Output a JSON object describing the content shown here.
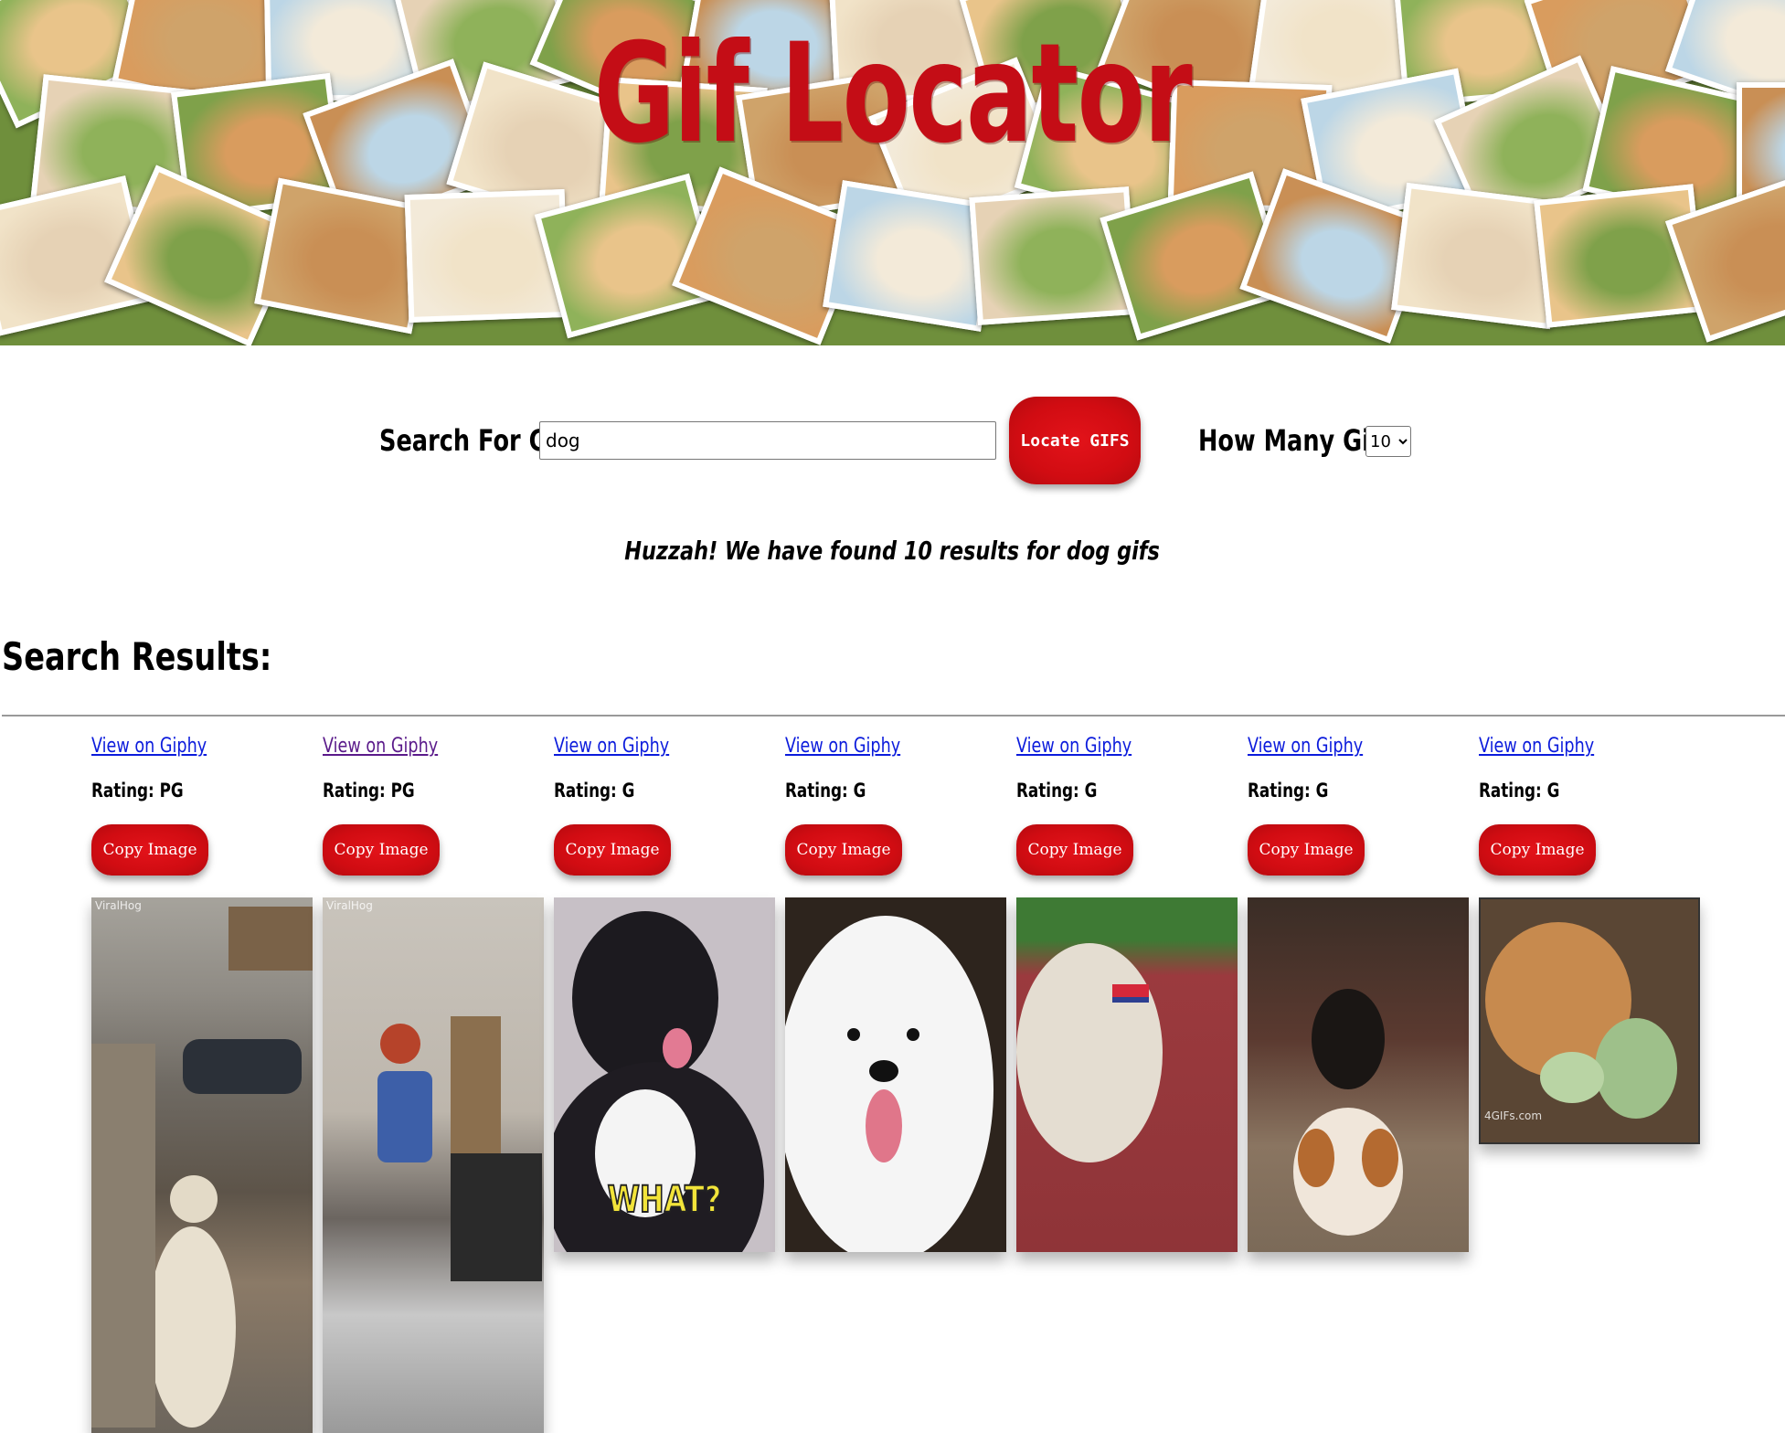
{
  "header": {
    "title": "Gif Locator",
    "banner_icon": "dog-collage-banner"
  },
  "search": {
    "label": "Search For Gif:",
    "value": "dog",
    "button_label": "Locate GIFS",
    "count_label": "How Many Gifs:",
    "count_value": "10"
  },
  "status": {
    "message": "Huzzah! We have found 10 results for dog gifs"
  },
  "results": {
    "heading": "Search Results:",
    "items": [
      {
        "link": "View on Giphy",
        "rating": "Rating: PG",
        "copy": "Copy Image",
        "watermark": "ViralHog",
        "caption": ""
      },
      {
        "link": "View on Giphy",
        "rating": "Rating: PG",
        "copy": "Copy Image",
        "watermark": "ViralHog",
        "caption": ""
      },
      {
        "link": "View on Giphy",
        "rating": "Rating: G",
        "copy": "Copy Image",
        "watermark": "",
        "caption": "WHAT?"
      },
      {
        "link": "View on Giphy",
        "rating": "Rating: G",
        "copy": "Copy Image",
        "watermark": "",
        "caption": ""
      },
      {
        "link": "View on Giphy",
        "rating": "Rating: G",
        "copy": "Copy Image",
        "watermark": "",
        "caption": ""
      },
      {
        "link": "View on Giphy",
        "rating": "Rating: G",
        "copy": "Copy Image",
        "watermark": "",
        "caption": ""
      },
      {
        "link": "View on Giphy",
        "rating": "Rating: G",
        "copy": "Copy Image",
        "watermark": "4GIFs.com",
        "caption": ""
      }
    ]
  },
  "colors": {
    "accent": "#d10c12",
    "title": "#c40d16",
    "link": "#0b1bdc",
    "visited_link": "#5a1a8a"
  }
}
